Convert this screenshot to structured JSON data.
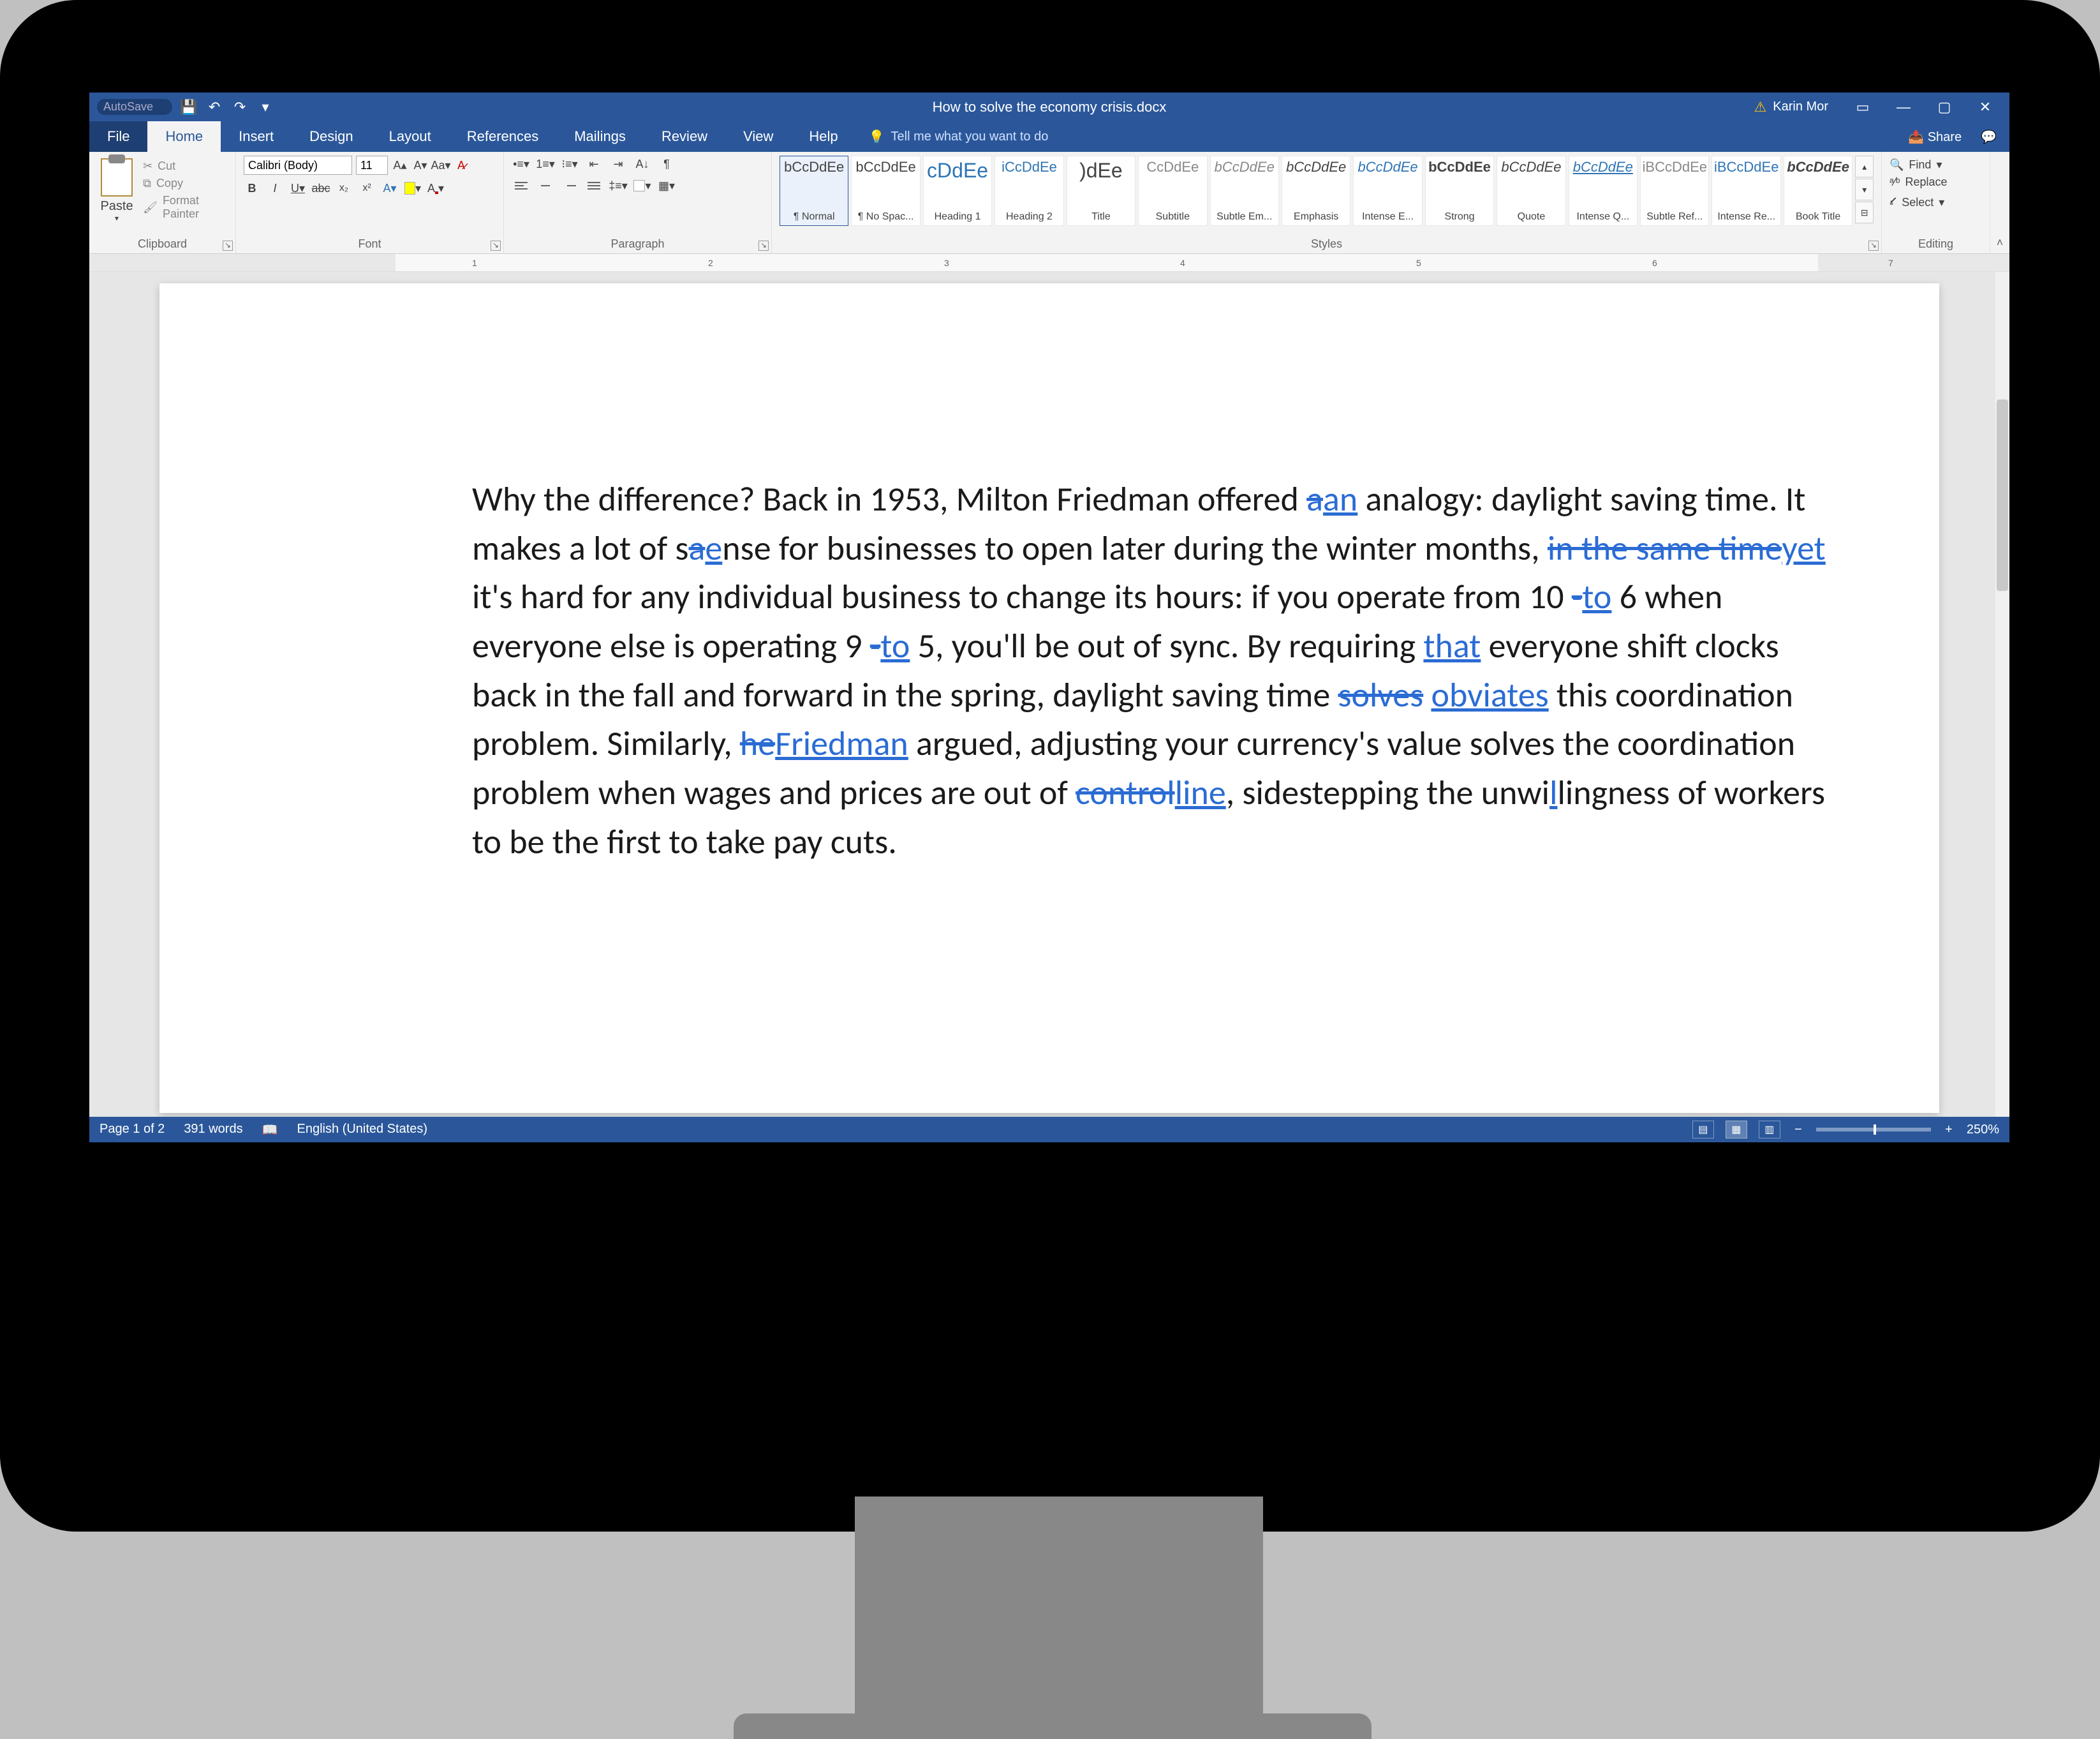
{
  "titlebar": {
    "autosave": "AutoSave",
    "doc_title": "How to solve the economy crisis.docx",
    "user": "Karin Mor"
  },
  "ribbon": {
    "tabs": [
      "File",
      "Home",
      "Insert",
      "Design",
      "Layout",
      "References",
      "Mailings",
      "Review",
      "View",
      "Help"
    ],
    "tellme": "Tell me what you want to do",
    "share": "Share"
  },
  "font": {
    "name": "Calibri (Body)",
    "size": "11"
  },
  "clipboard": {
    "paste": "Paste",
    "cut": "Cut",
    "copy": "Copy",
    "format_painter": "Format Painter",
    "label": "Clipboard"
  },
  "font_group_label": "Font",
  "para_group_label": "Paragraph",
  "styles_label": "Styles",
  "styles": [
    {
      "prev": "bCcDdEe",
      "name": "¶ Normal",
      "sel": true
    },
    {
      "prev": "bCcDdEe",
      "name": "¶ No Spac...",
      "sel": false
    },
    {
      "prev": "cDdEe",
      "name": "Heading 1",
      "sel": false,
      "color": "#2e74b5",
      "big": true
    },
    {
      "prev": "iCcDdEe",
      "name": "Heading 2",
      "sel": false,
      "color": "#2e74b5"
    },
    {
      "prev": ")dEe",
      "name": "Title",
      "sel": false,
      "big": true
    },
    {
      "prev": "CcDdEe",
      "name": "Subtitle",
      "sel": false,
      "color": "#888"
    },
    {
      "prev": "bCcDdEe",
      "name": "Subtle Em...",
      "sel": false,
      "ital": true,
      "color": "#888"
    },
    {
      "prev": "bCcDdEe",
      "name": "Emphasis",
      "sel": false,
      "ital": true
    },
    {
      "prev": "bCcDdEe",
      "name": "Intense E...",
      "sel": false,
      "ital": true,
      "color": "#2e74b5"
    },
    {
      "prev": "bCcDdEe",
      "name": "Strong",
      "sel": false,
      "bold": true
    },
    {
      "prev": "bCcDdEe",
      "name": "Quote",
      "sel": false,
      "ital": true
    },
    {
      "prev": "bCcDdEe",
      "name": "Intense Q...",
      "sel": false,
      "ital": true,
      "color": "#2e74b5",
      "ul": true
    },
    {
      "prev": "iBCcDdEe",
      "name": "Subtle Ref...",
      "sel": false,
      "color": "#888"
    },
    {
      "prev": "iBCcDdEe",
      "name": "Intense Re...",
      "sel": false,
      "color": "#2e74b5"
    },
    {
      "prev": "bCcDdEe",
      "name": "Book Title",
      "sel": false,
      "bold": true,
      "ital": true
    }
  ],
  "editing": {
    "find": "Find",
    "replace": "Replace",
    "select": "Select",
    "label": "Editing"
  },
  "ruler_nums": [
    "1",
    "2",
    "3",
    "4",
    "5",
    "6",
    "7"
  ],
  "doc": {
    "segments": [
      {
        "t": "Why the difference? Back in 1953, Milton Friedman offered "
      },
      {
        "t": "a",
        "cls": "del"
      },
      {
        "t": "an",
        "cls": "ins"
      },
      {
        "t": " analogy: daylight saving time. It makes a lot of s"
      },
      {
        "t": "a",
        "cls": "del"
      },
      {
        "t": "e",
        "cls": "ins"
      },
      {
        "t": "nse for businesses to open later during the winter months, "
      },
      {
        "t": "in the same time",
        "cls": "del"
      },
      {
        "t": "yet",
        "cls": "ins"
      },
      {
        "t": " it's hard for any individual business to change its hours: if you operate from 10 "
      },
      {
        "t": "-",
        "cls": "del"
      },
      {
        "t": "to",
        "cls": "ins"
      },
      {
        "t": " 6 when everyone else is operating 9 "
      },
      {
        "t": "-",
        "cls": "del"
      },
      {
        "t": "to",
        "cls": "ins"
      },
      {
        "t": " 5, you'll be out of sync. By requiring "
      },
      {
        "t": "that",
        "cls": "ins"
      },
      {
        "t": " everyone shift clocks back in the fall and forward in the spring, daylight saving time "
      },
      {
        "t": "solves",
        "cls": "del"
      },
      {
        "t": " "
      },
      {
        "t": "obviates",
        "cls": "ins"
      },
      {
        "t": " this coordination problem. Similarly, "
      },
      {
        "t": "he",
        "cls": "del"
      },
      {
        "t": "Friedman",
        "cls": "ins"
      },
      {
        "t": " argued, adjusting your currency's value solves the coordination problem when wages and prices are out of "
      },
      {
        "t": "control",
        "cls": "del"
      },
      {
        "t": "line",
        "cls": "ins"
      },
      {
        "t": ", sidestepping the unwi"
      },
      {
        "t": "l",
        "cls": "ins"
      },
      {
        "t": "lingness of workers to be the first to take pay cuts."
      }
    ]
  },
  "status": {
    "page": "Page 1 of 2",
    "words": "391 words",
    "lang": "English (United States)",
    "zoom": "250%"
  }
}
